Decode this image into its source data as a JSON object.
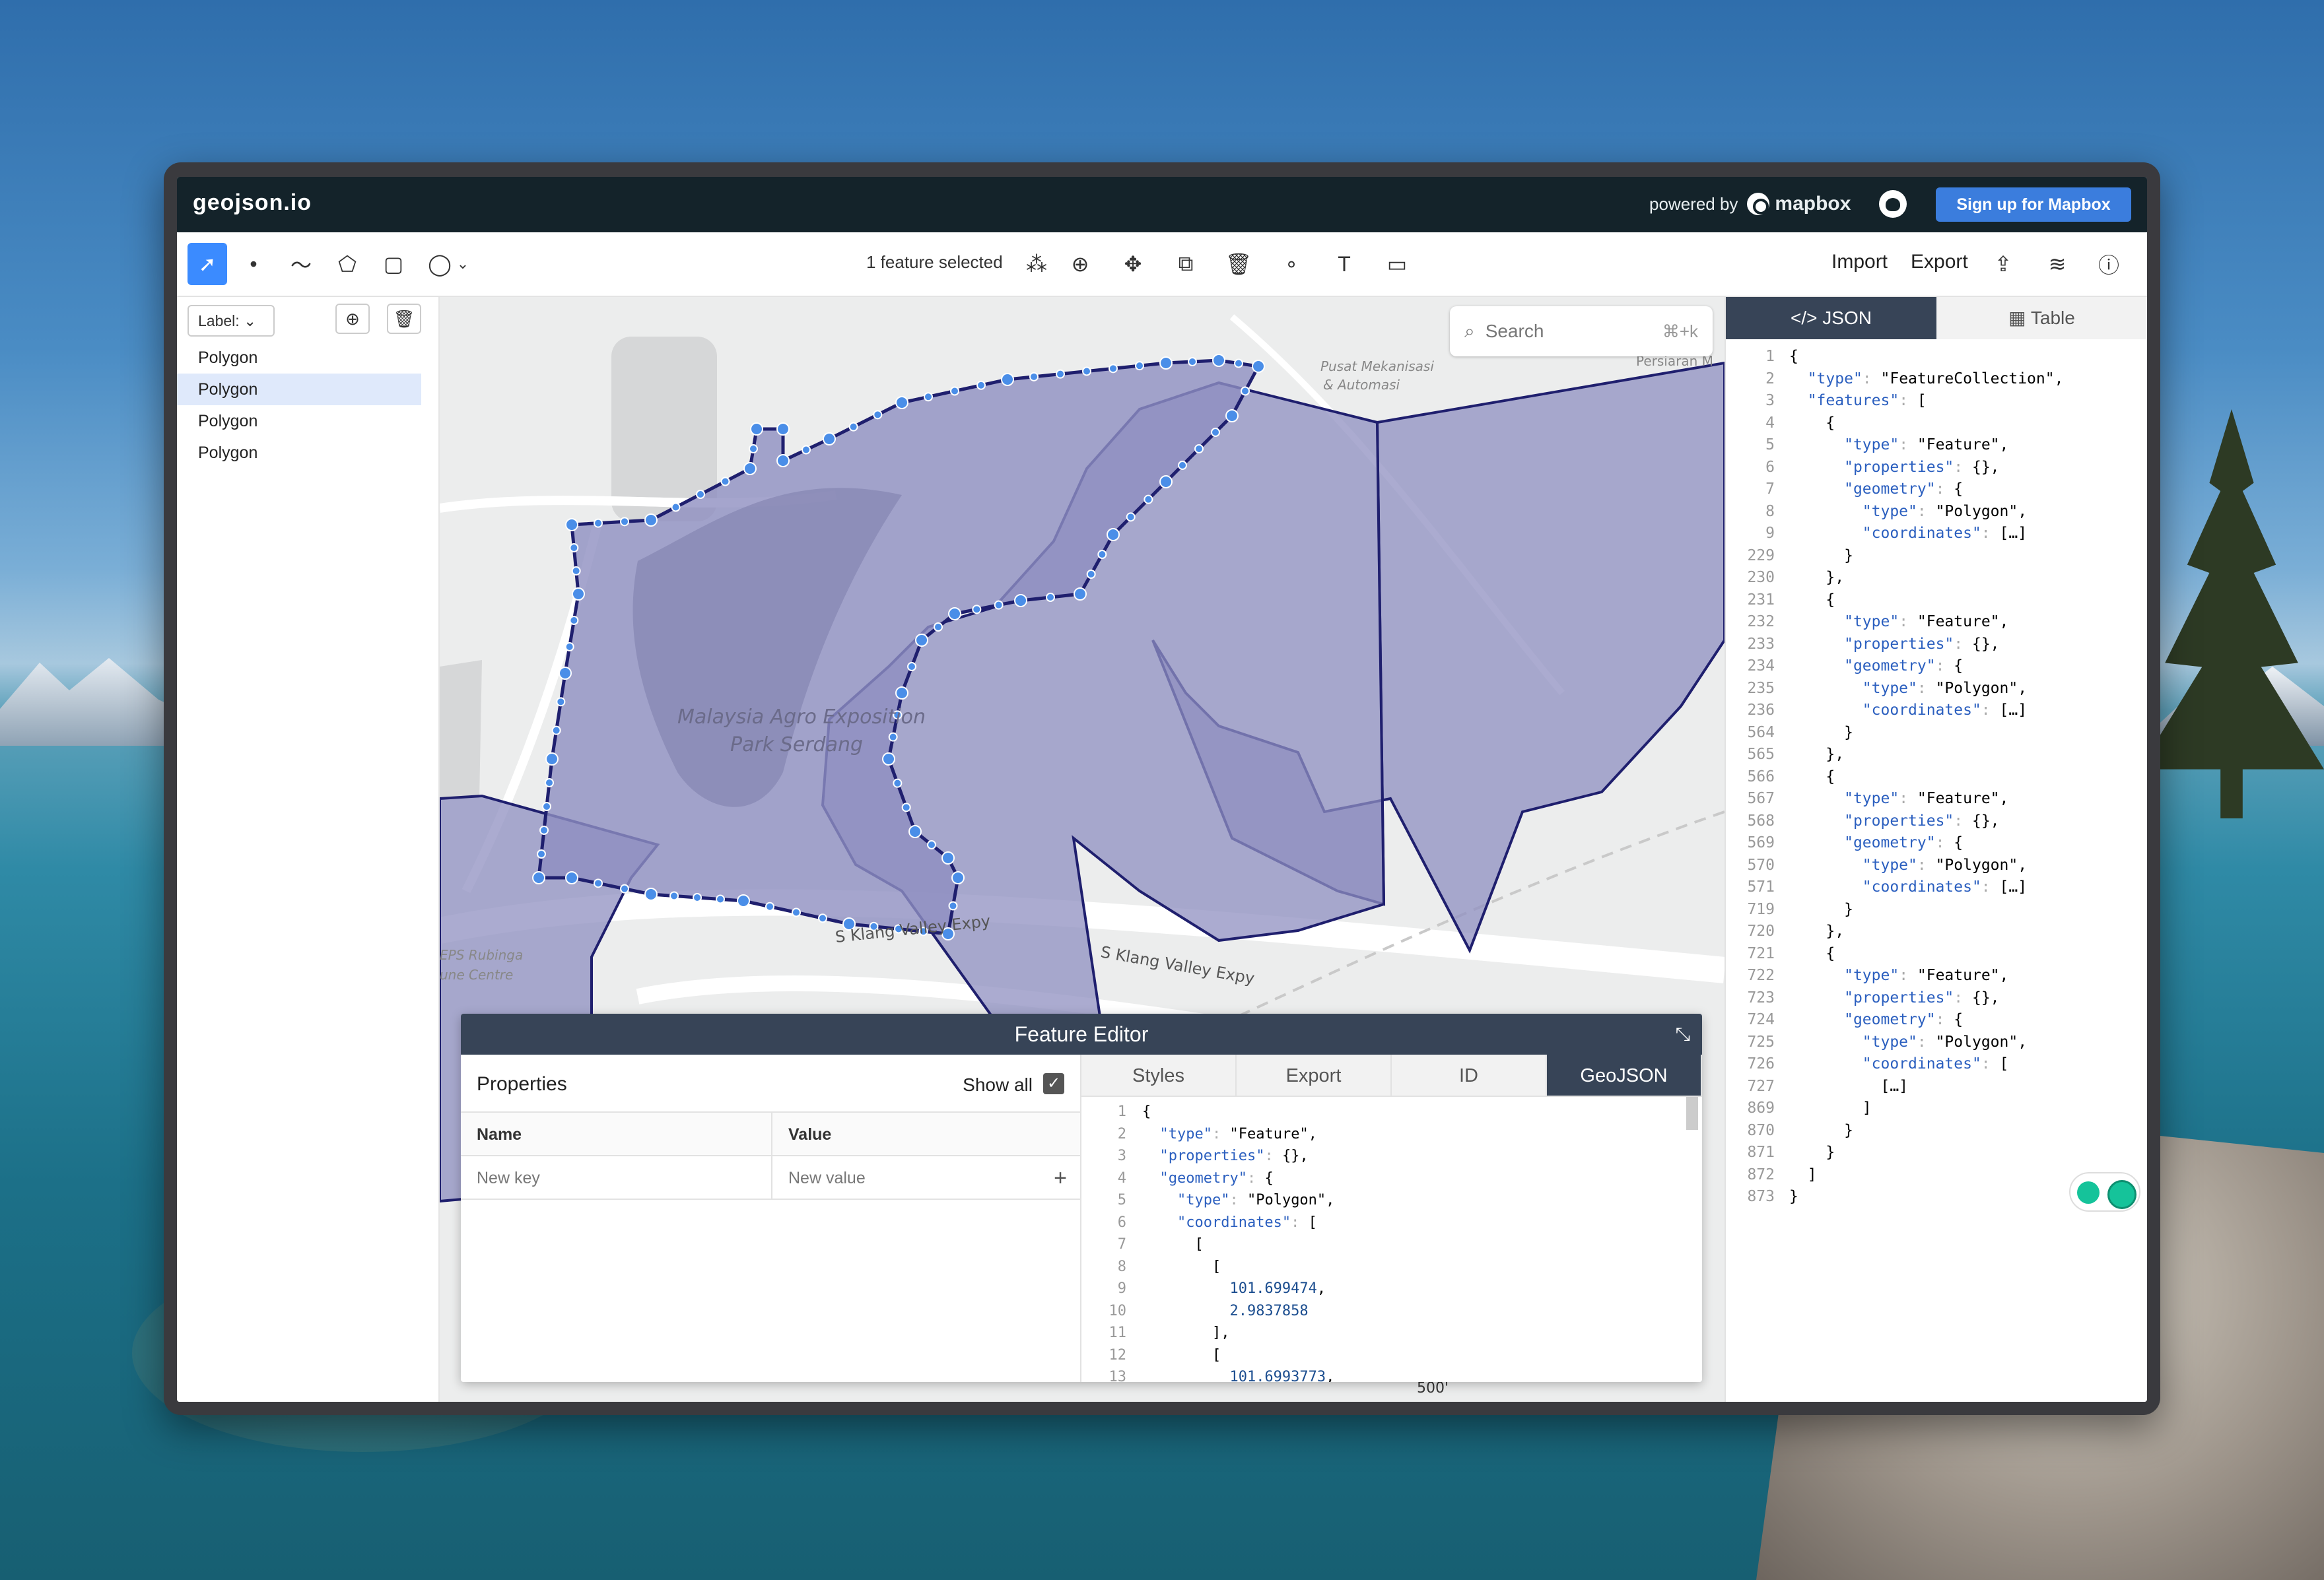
{
  "app": {
    "brand": "geojson.io",
    "powered_by": "powered by",
    "mapbox": "mapbox",
    "signup": "Sign up for Mapbox"
  },
  "toolbar": {
    "selection_status": "1 feature selected",
    "import": "Import",
    "export": "Export"
  },
  "sidebar": {
    "label_select": "Label:",
    "items": [
      "Polygon",
      "Polygon",
      "Polygon",
      "Polygon"
    ],
    "selected_index": 1
  },
  "map": {
    "search_placeholder": "Search",
    "search_shortcut": "⌘+k",
    "labels": {
      "park1": "Malaysia Agro Exposition",
      "park2": "Park Serdang",
      "road1": "S Klang Valley Expy",
      "road2": "S Klang Valley Expy",
      "poi1": "Pusat Mekanisasi",
      "poi2": "& Automasi",
      "poi3": "Persiaran M",
      "poi4": "EPS Rubinga",
      "poi5": "une Centre",
      "scale": "500'"
    }
  },
  "editor": {
    "title": "Feature Editor",
    "properties_title": "Properties",
    "show_all": "Show all",
    "col_name": "Name",
    "col_value": "Value",
    "new_key": "New key",
    "new_value": "New value",
    "tabs": [
      "Styles",
      "Export",
      "ID",
      "GeoJSON"
    ],
    "active_tab": "GeoJSON",
    "code_lines": [
      {
        "n": "1",
        "t": "{"
      },
      {
        "n": "2",
        "t": "  \"type\": \"Feature\","
      },
      {
        "n": "3",
        "t": "  \"properties\": {},"
      },
      {
        "n": "4",
        "t": "  \"geometry\": {"
      },
      {
        "n": "5",
        "t": "    \"type\": \"Polygon\","
      },
      {
        "n": "6",
        "t": "    \"coordinates\": ["
      },
      {
        "n": "7",
        "t": "      ["
      },
      {
        "n": "8",
        "t": "        ["
      },
      {
        "n": "9",
        "t": "          101.699474,"
      },
      {
        "n": "10",
        "t": "          2.9837858"
      },
      {
        "n": "11",
        "t": "        ],"
      },
      {
        "n": "12",
        "t": "        ["
      },
      {
        "n": "13",
        "t": "          101.6993773,"
      }
    ]
  },
  "right_panel": {
    "tabs": [
      "JSON",
      "Table"
    ],
    "active_tab": "JSON",
    "code_lines": [
      {
        "n": "1",
        "t": "{"
      },
      {
        "n": "2",
        "t": "  \"type\": \"FeatureCollection\","
      },
      {
        "n": "3",
        "t": "  \"features\": ["
      },
      {
        "n": "4",
        "t": "    {"
      },
      {
        "n": "5",
        "t": "      \"type\": \"Feature\","
      },
      {
        "n": "6",
        "t": "      \"properties\": {},"
      },
      {
        "n": "7",
        "t": "      \"geometry\": {"
      },
      {
        "n": "8",
        "t": "        \"type\": \"Polygon\","
      },
      {
        "n": "9",
        "t": "        \"coordinates\": […]"
      },
      {
        "n": "229",
        "t": "      }"
      },
      {
        "n": "230",
        "t": "    },"
      },
      {
        "n": "231",
        "t": "    {"
      },
      {
        "n": "232",
        "t": "      \"type\": \"Feature\","
      },
      {
        "n": "233",
        "t": "      \"properties\": {},"
      },
      {
        "n": "234",
        "t": "      \"geometry\": {"
      },
      {
        "n": "235",
        "t": "        \"type\": \"Polygon\","
      },
      {
        "n": "236",
        "t": "        \"coordinates\": […]"
      },
      {
        "n": "564",
        "t": "      }"
      },
      {
        "n": "565",
        "t": "    },"
      },
      {
        "n": "566",
        "t": "    {"
      },
      {
        "n": "567",
        "t": "      \"type\": \"Feature\","
      },
      {
        "n": "568",
        "t": "      \"properties\": {},"
      },
      {
        "n": "569",
        "t": "      \"geometry\": {"
      },
      {
        "n": "570",
        "t": "        \"type\": \"Polygon\","
      },
      {
        "n": "571",
        "t": "        \"coordinates\": […]"
      },
      {
        "n": "719",
        "t": "      }"
      },
      {
        "n": "720",
        "t": "    },"
      },
      {
        "n": "721",
        "t": "    {"
      },
      {
        "n": "722",
        "t": "      \"type\": \"Feature\","
      },
      {
        "n": "723",
        "t": "      \"properties\": {},"
      },
      {
        "n": "724",
        "t": "      \"geometry\": {"
      },
      {
        "n": "725",
        "t": "        \"type\": \"Polygon\","
      },
      {
        "n": "726",
        "t": "        \"coordinates\": ["
      },
      {
        "n": "727",
        "t": "          […]"
      },
      {
        "n": "869",
        "t": "        ]"
      },
      {
        "n": "870",
        "t": "      }"
      },
      {
        "n": "871",
        "t": "    }"
      },
      {
        "n": "872",
        "t": "  ]"
      },
      {
        "n": "873",
        "t": "}"
      }
    ]
  },
  "colors": {
    "topbar": "#14232a",
    "accent": "#3b7ddd",
    "polygon_fill": "#8f8fc0",
    "polygon_stroke": "#1f1f6e",
    "vertex": "#4a8ee8",
    "panel_header": "#374457"
  }
}
